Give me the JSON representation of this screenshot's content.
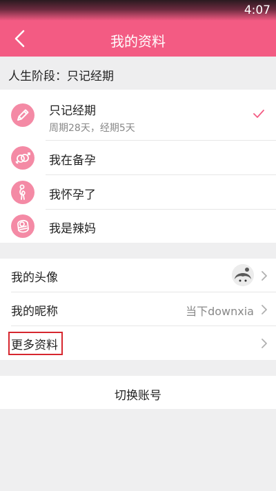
{
  "status_bar": {
    "time": "4:07"
  },
  "app_bar": {
    "title": "我的资料",
    "back_icon": "chevron-left-icon"
  },
  "stage_header": {
    "label": "人生阶段：只记经期"
  },
  "stages": [
    {
      "label": "只记经期",
      "sub": "周期28天，经期5天",
      "icon": "pencil-icon",
      "selected": true
    },
    {
      "label": "我在备孕",
      "sub": "",
      "icon": "gender-rings-icon",
      "selected": false
    },
    {
      "label": "我怀孕了",
      "sub": "",
      "icon": "pregnant-icon",
      "selected": false
    },
    {
      "label": "我是辣妈",
      "sub": "",
      "icon": "baby-icon",
      "selected": false
    }
  ],
  "profile": {
    "avatar_label": "我的头像",
    "nickname_label": "我的昵称",
    "nickname_value": "当下downxia",
    "more_label": "更多资料"
  },
  "switch_account": {
    "label": "切换账号"
  },
  "colors": {
    "accent": "#f35b83",
    "icon_bg": "#f48aa5",
    "highlight_box": "#d6262e",
    "background": "#efeff0"
  }
}
